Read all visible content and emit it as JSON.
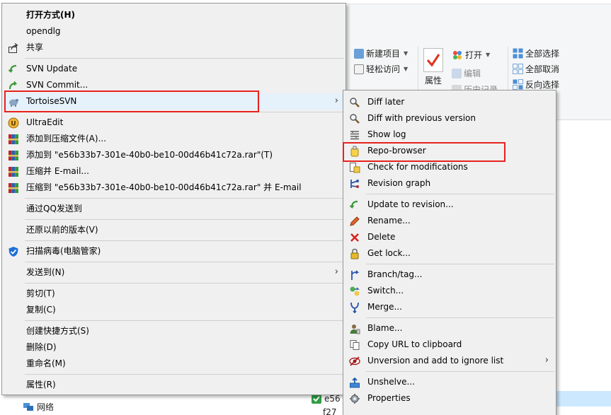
{
  "ribbon": {
    "new_item": "新建项目",
    "easy_access": "轻松访问",
    "properties": "属性",
    "open": "打开",
    "edit": "编辑",
    "history": "历史记录",
    "select_all": "全部选择",
    "select_none": "全部取消",
    "invert_selection": "反向选择"
  },
  "files": {
    "file1": "e56",
    "file2": "f27"
  },
  "nav": {
    "network": "网络"
  },
  "main_menu": {
    "open_with": "打开方式(H)",
    "opendlg": "opendlg",
    "share": "共享",
    "svn_update": "SVN Update",
    "svn_commit": "SVN Commit...",
    "tortoisesvn": "TortoiseSVN",
    "ultraedit": "UltraEdit",
    "add_archive": "添加到压缩文件(A)...",
    "add_to_rar": "添加到 \"e56b33b7-301e-40b0-be10-00d46b41c72a.rar\"(T)",
    "compress_email": "压缩并 E-mail...",
    "compress_to_rar_email": "压缩到 \"e56b33b7-301e-40b0-be10-00d46b41c72a.rar\" 并 E-mail",
    "send_qq": "通过QQ发送到",
    "restore_prev": "还原以前的版本(V)",
    "scan_virus": "扫描病毒(电脑管家)",
    "send_to": "发送到(N)",
    "cut": "剪切(T)",
    "copy": "复制(C)",
    "create_shortcut": "创建快捷方式(S)",
    "delete": "删除(D)",
    "rename": "重命名(M)",
    "properties": "属性(R)"
  },
  "sub_menu": {
    "diff_later": "Diff later",
    "diff_prev": "Diff with previous version",
    "show_log": "Show log",
    "repo_browser": "Repo-browser",
    "check_mods": "Check for modifications",
    "rev_graph": "Revision graph",
    "update_rev": "Update to revision...",
    "rename": "Rename...",
    "delete": "Delete",
    "get_lock": "Get lock...",
    "branch_tag": "Branch/tag...",
    "switch": "Switch...",
    "merge": "Merge...",
    "blame": "Blame...",
    "copy_url": "Copy URL to clipboard",
    "unversion": "Unversion and add to ignore list",
    "unshelve": "Unshelve...",
    "properties": "Properties"
  },
  "colors": {
    "highlight_box": "#e8211e",
    "menu_bg": "#f0f0f0",
    "selection": "#cce8ff"
  }
}
